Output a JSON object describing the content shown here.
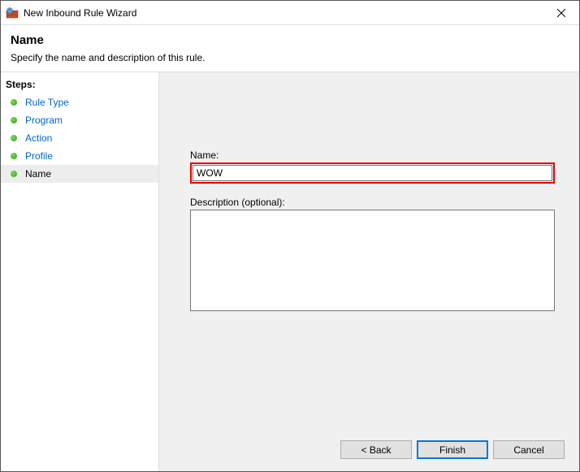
{
  "titlebar": {
    "title": "New Inbound Rule Wizard"
  },
  "header": {
    "title": "Name",
    "description": "Specify the name and description of this rule."
  },
  "sidebar": {
    "steps_label": "Steps:",
    "items": [
      {
        "label": "Rule Type",
        "completed": true
      },
      {
        "label": "Program",
        "completed": true
      },
      {
        "label": "Action",
        "completed": true
      },
      {
        "label": "Profile",
        "completed": true
      },
      {
        "label": "Name",
        "current": true
      }
    ]
  },
  "form": {
    "name_label": "Name:",
    "name_value": "WOW",
    "description_label": "Description (optional):",
    "description_value": ""
  },
  "buttons": {
    "back": "< Back",
    "finish": "Finish",
    "cancel": "Cancel"
  }
}
